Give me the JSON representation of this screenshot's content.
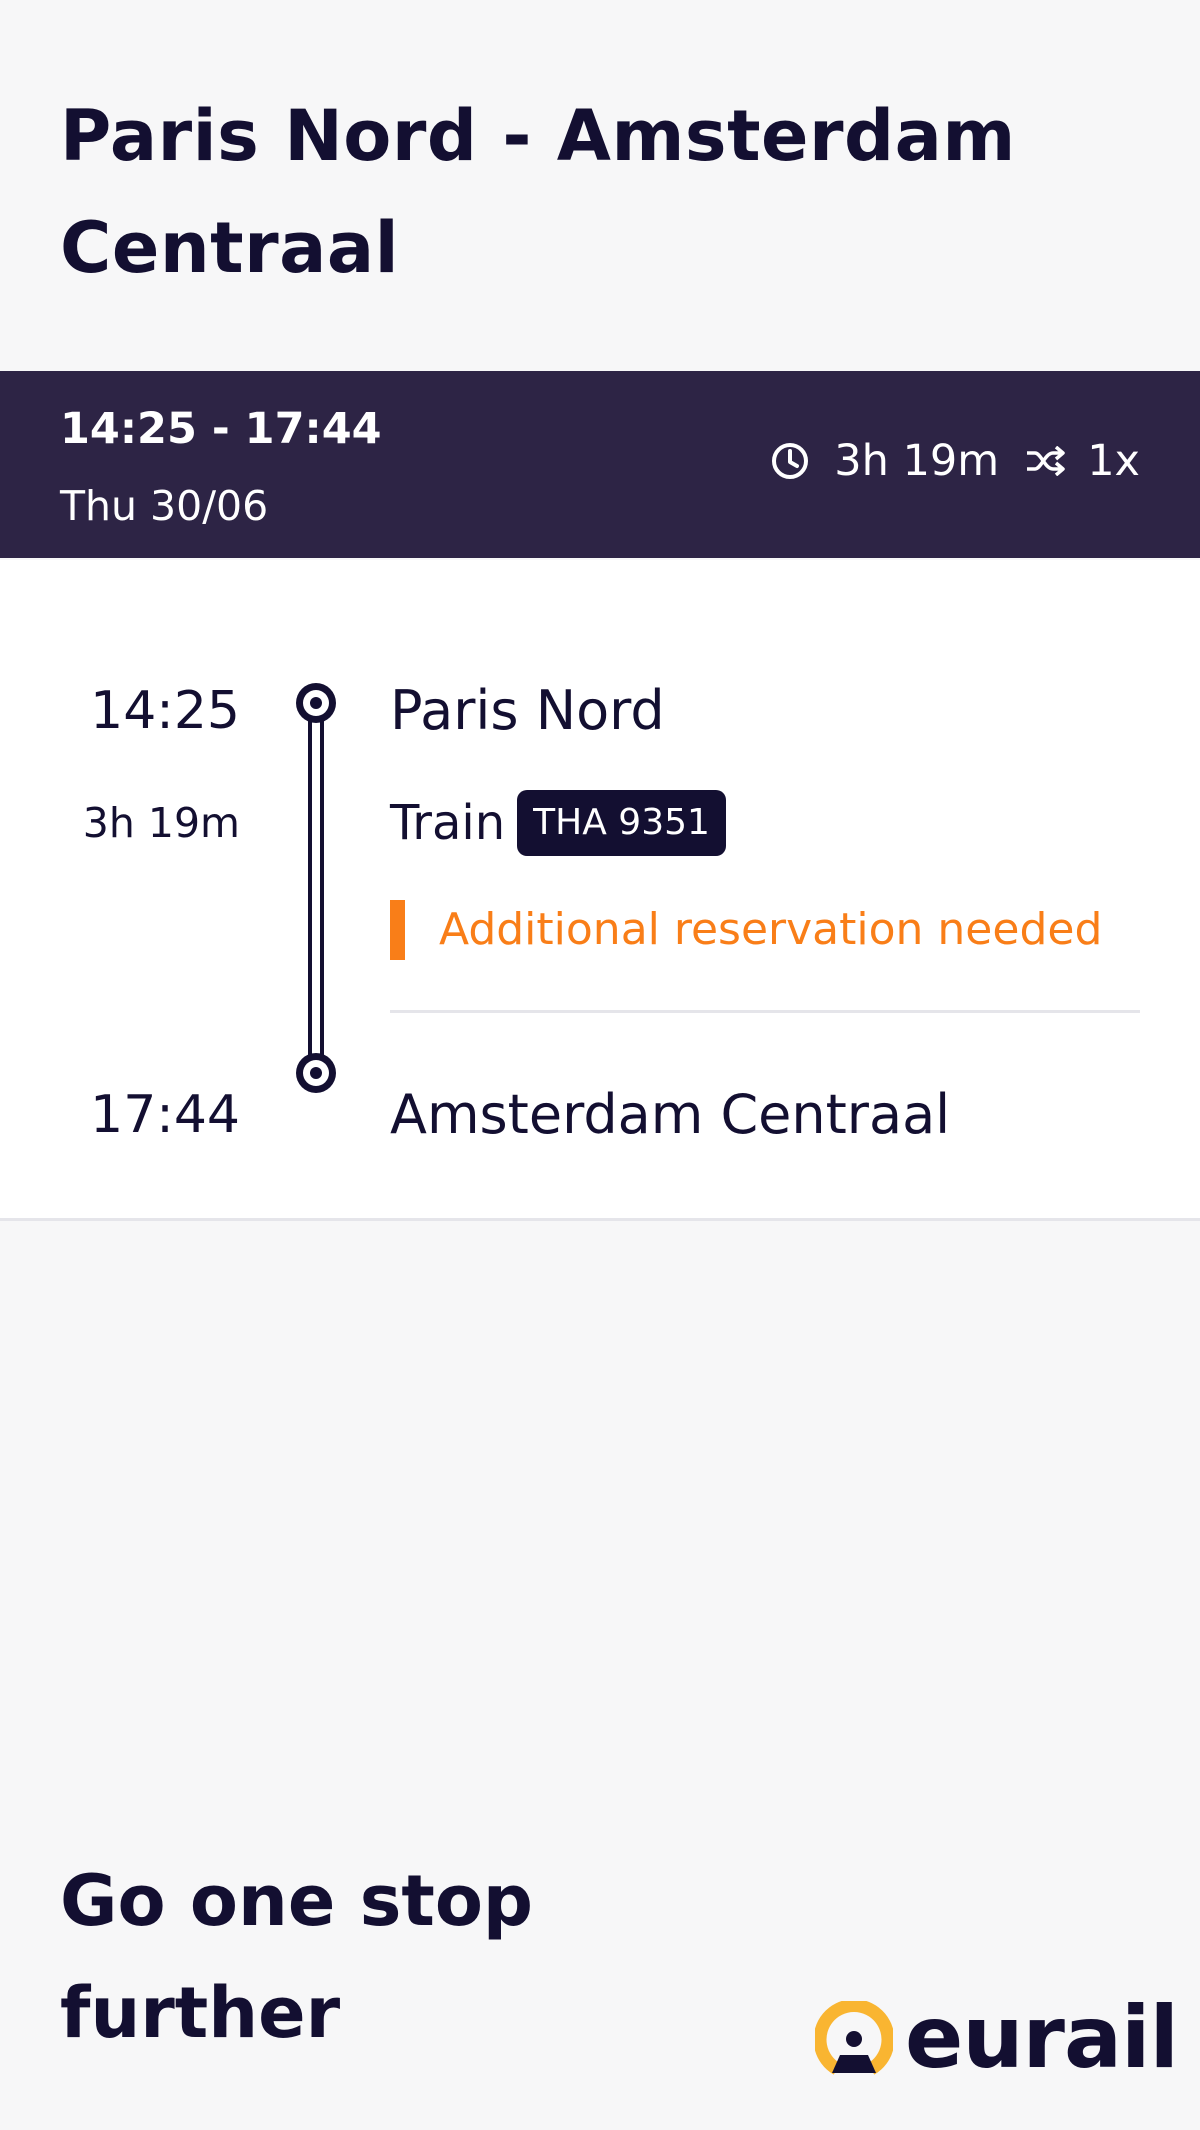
{
  "header": {
    "title": "Paris Nord - Amsterdam Centraal"
  },
  "summary": {
    "time_range": "14:25 - 17:44",
    "date": "Thu 30/06",
    "duration": "3h 19m",
    "transfers": "1x",
    "duration_icon": "clock-icon",
    "transfers_icon": "transfer-icon"
  },
  "journey": {
    "departure_time": "14:25",
    "departure_station": "Paris Nord",
    "leg_duration": "3h 19m",
    "mode_label": "Train",
    "train_number": "THA 9351",
    "notice": "Additional reservation needed",
    "notice_color": "#f97e18",
    "arrival_time": "17:44",
    "arrival_station": "Amsterdam Centraal"
  },
  "footer": {
    "slogan": "Go one stop further",
    "logo_text": "eurail",
    "logo_accent_color": "#f9b531"
  },
  "colors": {
    "primary": "#130f31",
    "summary_bar": "#2d2445",
    "background": "#f7f7f8"
  }
}
